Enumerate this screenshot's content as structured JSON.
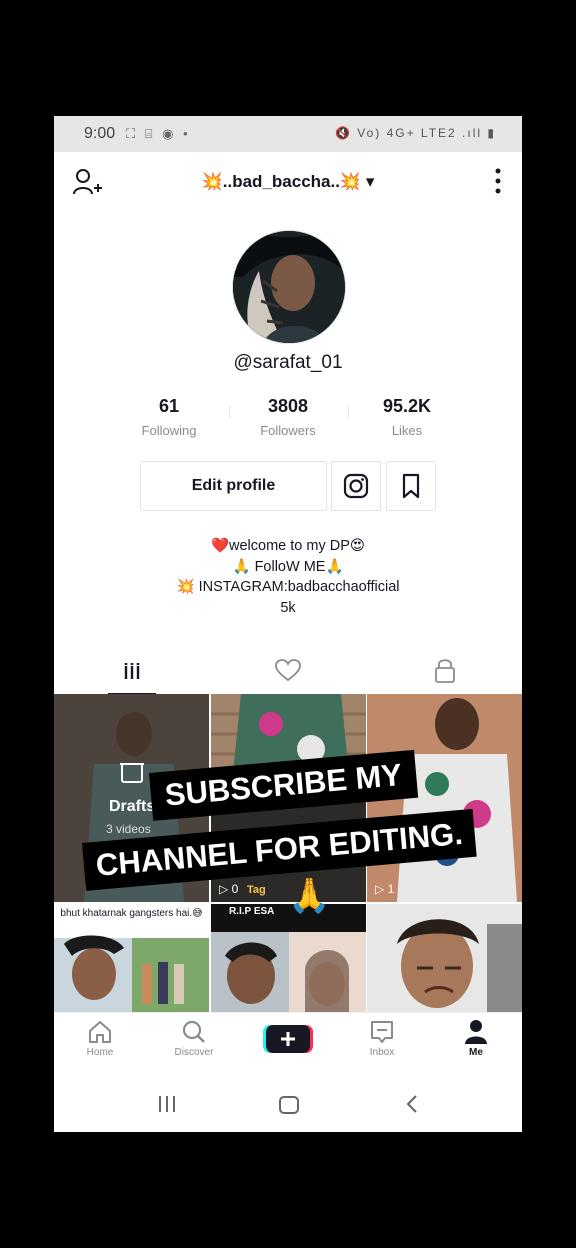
{
  "status_bar": {
    "time": "9:00",
    "left_icons": "⛶ ⌸ ◉ •",
    "right_icons": "🔇 Vo) 4G+ LTE2 .ıll ▮"
  },
  "header": {
    "username": "💥..bad_baccha..💥",
    "dropdown_glyph": "▾"
  },
  "profile": {
    "handle": "@sarafat_01"
  },
  "stats": [
    {
      "value": "61",
      "label": "Following"
    },
    {
      "value": "3808",
      "label": "Followers"
    },
    {
      "value": "95.2K",
      "label": "Likes"
    }
  ],
  "buttons": {
    "edit_profile": "Edit profile"
  },
  "bio": [
    "❤️welcome to my DP😍",
    "🙏 FolloW ME🙏",
    "💥 INSTAGRAM:badbacchaofficial",
    "5k"
  ],
  "grid": {
    "drafts_label": "Drafts",
    "drafts_sub": "3 videos",
    "video2_views": "▷ 0",
    "video2_tag": "Tag",
    "video3_views": "▷ 1",
    "caption_cell4": "bhut khatarnak gangsters hai.😅",
    "caption_cell5": "R.I.P ESA",
    "pray_emoji": "🙏"
  },
  "overlay": {
    "line1": "SUBSCRIBE MY",
    "line2": "CHANNEL FOR EDITING."
  },
  "bottom_nav": [
    {
      "label": "Home",
      "icon": "home-icon"
    },
    {
      "label": "Discover",
      "icon": "search-icon"
    },
    {
      "label": "",
      "icon": "plus-icon"
    },
    {
      "label": "Inbox",
      "icon": "inbox-icon"
    },
    {
      "label": "Me",
      "icon": "person-icon"
    }
  ],
  "colors": {
    "accent_red": "#fe2c55",
    "accent_cyan": "#25f4ee",
    "text": "#161823",
    "muted": "#8a8b91"
  }
}
